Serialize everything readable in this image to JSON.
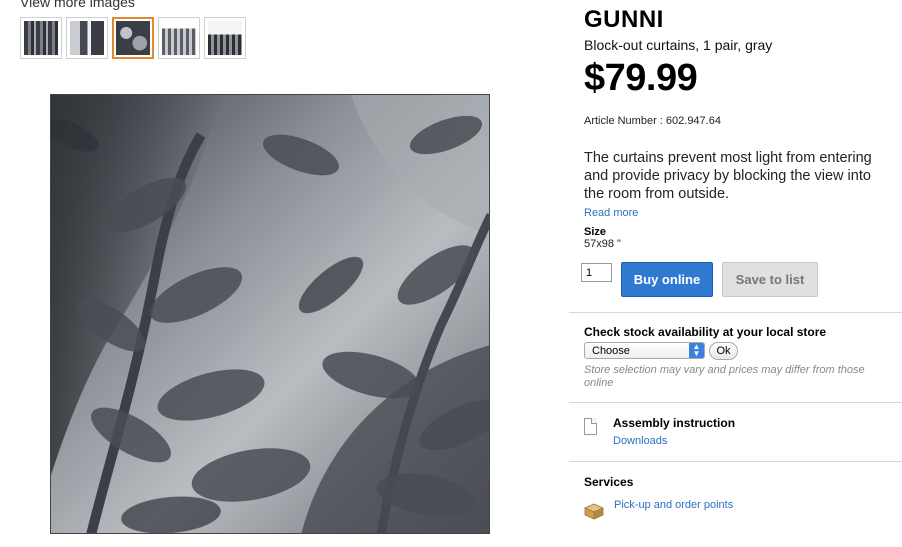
{
  "gallery": {
    "view_more_label": "View more images",
    "thumbnails": [
      {
        "name": "curtain-pair-front"
      },
      {
        "name": "curtain-in-room"
      },
      {
        "name": "fabric-closeup"
      },
      {
        "name": "curtain-heading"
      },
      {
        "name": "curtain-hem"
      }
    ],
    "selected_index": 2
  },
  "product": {
    "name": "GUNNI",
    "subtitle": "Block-out curtains, 1 pair, gray",
    "price": "$79.99",
    "article_number": "Article Number : 602.947.64",
    "description": "The curtains prevent most light from entering and provide privacy by blocking the view into the room from outside.",
    "read_more": "Read more",
    "size_label": "Size",
    "size_value": "57x98 \""
  },
  "purchase": {
    "quantity": "1",
    "buy_label": "Buy online",
    "save_label": "Save to list"
  },
  "stock": {
    "title": "Check stock availability at your local store",
    "store_select_value": "Choose",
    "ok_label": "Ok",
    "note": "Store selection may vary and prices may differ from those online"
  },
  "assembly": {
    "title": "Assembly instruction",
    "downloads": "Downloads"
  },
  "services": {
    "title": "Services",
    "pickup": "Pick-up and order points"
  },
  "colors": {
    "buy_button": "#2f7ad0",
    "link": "#2a71c1",
    "selected_thumb_border": "#e38a2e",
    "save_button": "#e0e0e0"
  }
}
